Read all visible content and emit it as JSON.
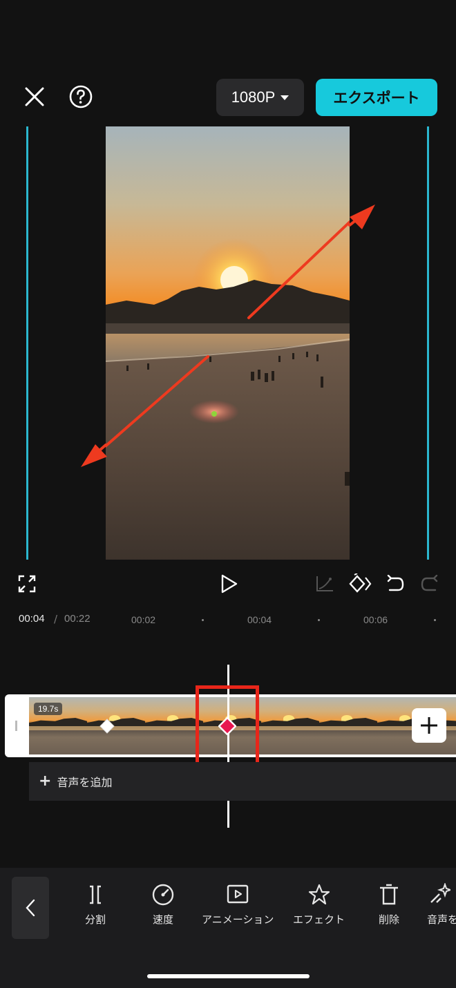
{
  "header": {
    "resolution_label": "1080P",
    "export_label": "エクスポート"
  },
  "timeline": {
    "current_time": "00:04",
    "separator": "/",
    "total_time": "00:22",
    "ticks": [
      "00:02",
      "00:04",
      "00:06"
    ],
    "clip_duration": "19.7s",
    "add_audio_label": "音声を追加"
  },
  "toolbar": {
    "items": [
      {
        "label": "分割",
        "icon": "split-icon"
      },
      {
        "label": "速度",
        "icon": "speed-icon"
      },
      {
        "label": "アニメーション",
        "icon": "animation-icon"
      },
      {
        "label": "エフェクト",
        "icon": "effect-icon"
      },
      {
        "label": "削除",
        "icon": "delete-icon"
      },
      {
        "label": "音声を",
        "icon": "voice-effect-icon"
      }
    ]
  },
  "colors": {
    "accent": "#17c9dc",
    "guide_lines": "#2bb7cf",
    "highlight_box": "#e8261a",
    "keyframe_active": "#e8174f"
  }
}
